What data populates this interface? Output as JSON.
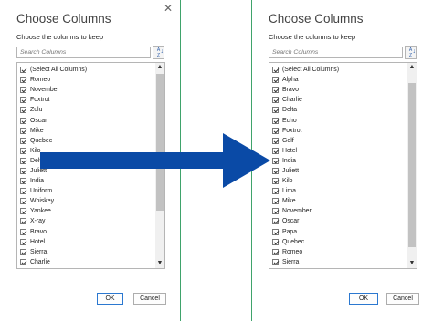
{
  "left_dialog": {
    "title": "Choose Columns",
    "subtitle": "Choose the columns to keep",
    "search_placeholder": "Search Columns",
    "items": [
      "(Select All Columns)",
      "Romeo",
      "November",
      "Foxtrot",
      "Zulu",
      "Oscar",
      "Mike",
      "Quebec",
      "Kilo",
      "Delta",
      "Juliett",
      "India",
      "Uniform",
      "Whiskey",
      "Yankee",
      "X-ray",
      "Bravo",
      "Hotel",
      "Sierra",
      "Charlie"
    ],
    "ok_label": "OK",
    "cancel_label": "Cancel"
  },
  "right_dialog": {
    "title": "Choose Columns",
    "subtitle": "Choose the columns to keep",
    "search_placeholder": "Search Columns",
    "items": [
      "(Select All Columns)",
      "Alpha",
      "Bravo",
      "Charlie",
      "Delta",
      "Echo",
      "Foxtrot",
      "Golf",
      "Hotel",
      "India",
      "Juliett",
      "Kilo",
      "Lima",
      "Mike",
      "November",
      "Oscar",
      "Papa",
      "Quebec",
      "Romeo",
      "Sierra"
    ],
    "ok_label": "OK",
    "cancel_label": "Cancel"
  },
  "icons": {
    "close": "close-icon",
    "sort": "sort-az-icon",
    "arrow": "right-arrow-icon"
  },
  "colors": {
    "arrow": "#0a4aa6",
    "divider": "#3fa36b",
    "ok_border": "#2b78d0"
  }
}
